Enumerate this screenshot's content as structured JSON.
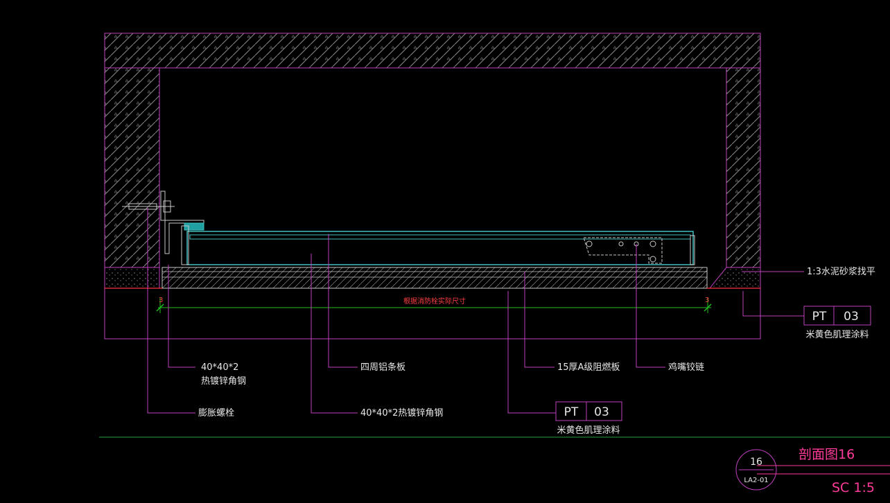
{
  "drawing": {
    "dimension_note": "根据消防栓实际尺寸",
    "dim_left_tick": "3",
    "dim_right_tick": "3"
  },
  "labels": {
    "angle_steel_a_line1": "40*40*2",
    "angle_steel_a_line2": "热镀锌角钢",
    "expansion_bolt": "膨胀螺栓",
    "aluminum_strip": "四周铝条板",
    "angle_steel_b": "40*40*2热镀锌角钢",
    "fire_board": "15厚A级阻燃板",
    "hinge": "鸡嘴铰链",
    "mortar": "1:3水泥砂浆找平"
  },
  "tags": {
    "bottom": {
      "code": "PT",
      "number": "03",
      "desc": "米黄色肌理涂料"
    },
    "right": {
      "code": "PT",
      "number": "03",
      "desc": "米黄色肌理涂料"
    }
  },
  "title_block": {
    "title": "剖面图16",
    "number": "16",
    "sheet": "LA2-01",
    "scale": "SC 1:5"
  },
  "colors": {
    "outline": "#c040c0",
    "hatch": "#8a8a8a",
    "panel": "#40c0c0",
    "dimension": "#20c020",
    "leader": "#c040c0",
    "text": "#e8e8e8",
    "title": "#ff3a9a"
  }
}
